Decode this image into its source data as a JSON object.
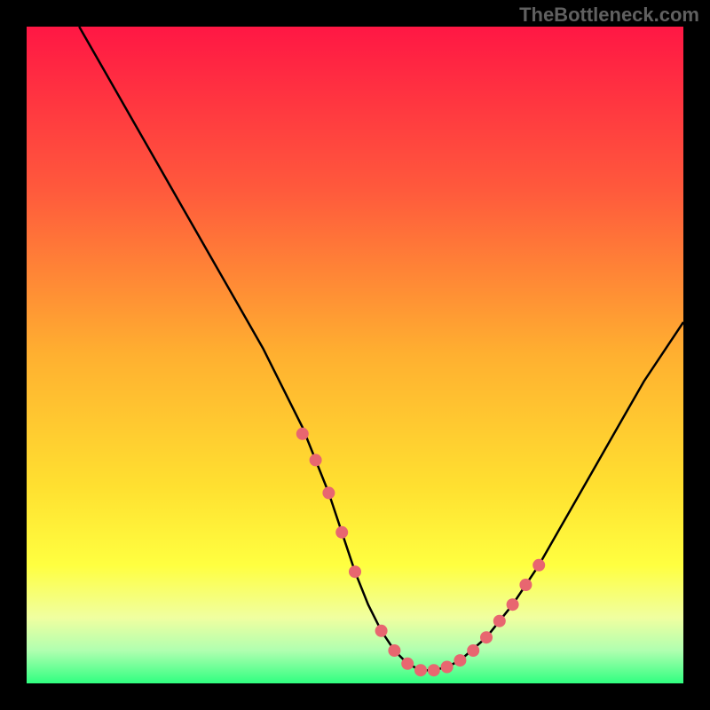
{
  "watermark": "TheBottleneck.com",
  "chart_data": {
    "type": "line",
    "title": "",
    "xlabel": "",
    "ylabel": "",
    "xlim": [
      0,
      100
    ],
    "ylim": [
      0,
      100
    ],
    "curve": {
      "x": [
        8,
        12,
        16,
        20,
        24,
        28,
        32,
        36,
        40,
        42,
        44,
        46,
        48,
        50,
        52,
        54,
        56,
        58,
        60,
        62,
        64,
        66,
        70,
        74,
        78,
        82,
        86,
        90,
        94,
        98,
        100
      ],
      "y": [
        100,
        93,
        86,
        79,
        72,
        65,
        58,
        51,
        43,
        39,
        34,
        29,
        23,
        17,
        12,
        8,
        5,
        3,
        2,
        2,
        2.5,
        3.5,
        7,
        12,
        18,
        25,
        32,
        39,
        46,
        52,
        55
      ]
    },
    "markers": {
      "x": [
        42,
        44,
        46,
        48,
        50,
        54,
        56,
        58,
        60,
        62,
        64,
        66,
        68,
        70,
        72,
        74,
        76,
        78
      ],
      "y": [
        38,
        34,
        29,
        23,
        17,
        8,
        5,
        3,
        2,
        2,
        2.5,
        3.5,
        5,
        7,
        9.5,
        12,
        15,
        18
      ]
    },
    "gradient_stops": [
      {
        "offset": 0.0,
        "color": "#ff1744"
      },
      {
        "offset": 0.25,
        "color": "#ff5a3c"
      },
      {
        "offset": 0.5,
        "color": "#ffb030"
      },
      {
        "offset": 0.7,
        "color": "#ffe030"
      },
      {
        "offset": 0.82,
        "color": "#ffff40"
      },
      {
        "offset": 0.9,
        "color": "#f0ffa0"
      },
      {
        "offset": 0.95,
        "color": "#b0ffb0"
      },
      {
        "offset": 1.0,
        "color": "#30ff80"
      }
    ],
    "marker_color": "#e86670",
    "curve_color": "#000000"
  }
}
